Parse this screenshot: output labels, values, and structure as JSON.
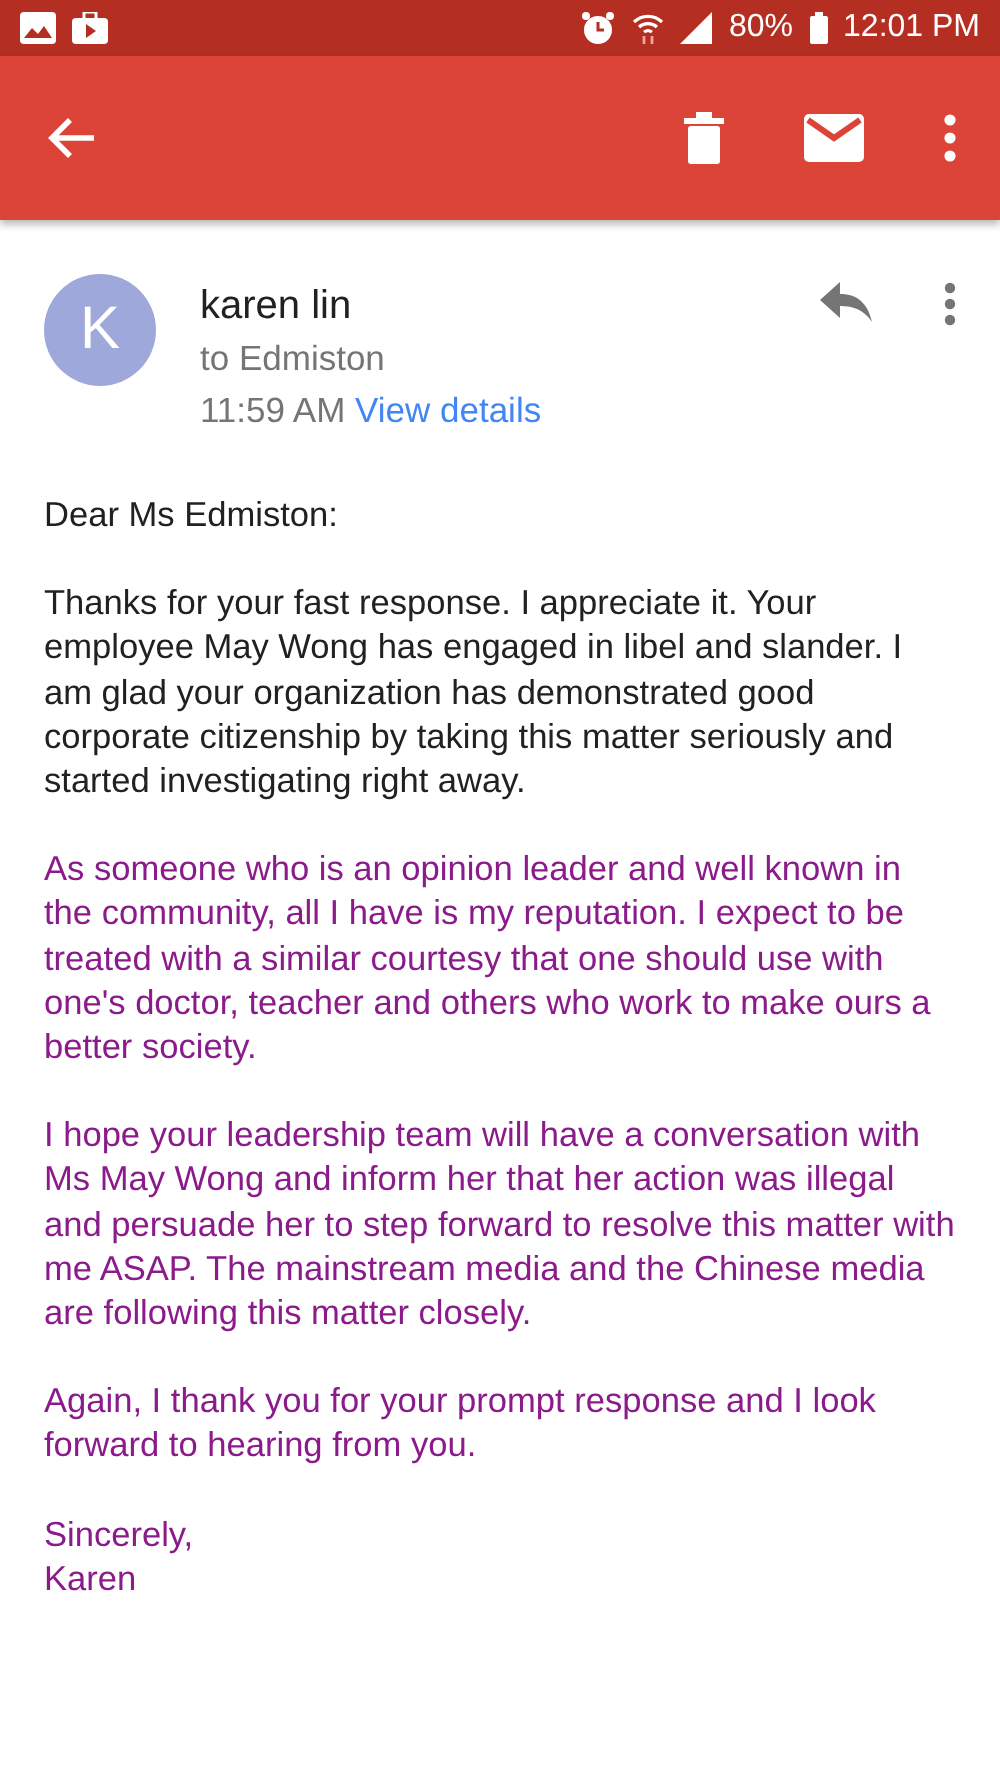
{
  "status_bar": {
    "battery": "80%",
    "time": "12:01 PM"
  },
  "message": {
    "avatar_letter": "K",
    "sender": "karen lin",
    "recipient": "to Edmiston",
    "time": "11:59 AM",
    "details_link": "View details"
  },
  "body": [
    {
      "text": "Dear Ms Edmiston:",
      "color": "#212121"
    },
    {
      "text": "Thanks for your fast response. I appreciate it. Your employee May Wong has engaged in libel and slander. I am glad your organization has demonstrated good corporate citizenship by taking this matter seriously and started investigating right away.",
      "color": "#212121"
    },
    {
      "text": "As someone who is an opinion leader and well known in the community, all I have is my reputation. I expect to be treated with a similar courtesy that one should use with one's doctor, teacher and others who work to make ours a better society.",
      "color": "#8b1a8b"
    },
    {
      "text": "I hope your leadership team will have a conversation with Ms May Wong and inform her that her action was illegal and persuade her to step forward to resolve this matter with me ASAP. The mainstream media and the Chinese media are following this matter closely.",
      "color": "#8b1a8b"
    },
    {
      "text": "Again, I thank you for your prompt response and I look forward to hearing from you.",
      "color": "#8b1a8b"
    },
    {
      "text": "Sincerely,\nKaren",
      "color": "#8b1a8b"
    }
  ]
}
